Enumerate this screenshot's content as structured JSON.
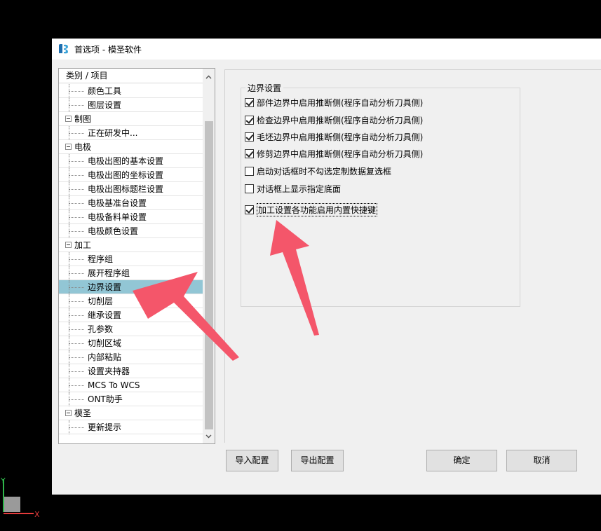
{
  "window": {
    "title": "首选项 - 模圣软件"
  },
  "tree": {
    "header": "类别 / 项目",
    "rows": [
      {
        "kind": "child",
        "label": "颜色工具"
      },
      {
        "kind": "child",
        "label": "图层设置"
      },
      {
        "kind": "group",
        "label": "制图"
      },
      {
        "kind": "child",
        "label": "正在研发中..."
      },
      {
        "kind": "group",
        "label": "电极"
      },
      {
        "kind": "child",
        "label": "电极出图的基本设置"
      },
      {
        "kind": "child",
        "label": "电极出图的坐标设置"
      },
      {
        "kind": "child",
        "label": "电极出图标题栏设置"
      },
      {
        "kind": "child",
        "label": "电极基准台设置"
      },
      {
        "kind": "child",
        "label": "电极备料单设置"
      },
      {
        "kind": "child",
        "label": "电极颜色设置"
      },
      {
        "kind": "group",
        "label": "加工"
      },
      {
        "kind": "child",
        "label": "程序组"
      },
      {
        "kind": "child",
        "label": "展开程序组"
      },
      {
        "kind": "child",
        "label": "边界设置",
        "selected": true
      },
      {
        "kind": "child",
        "label": "切削层"
      },
      {
        "kind": "child",
        "label": "继承设置"
      },
      {
        "kind": "child",
        "label": "孔参数"
      },
      {
        "kind": "child",
        "label": "切削区域"
      },
      {
        "kind": "child",
        "label": "内部粘贴"
      },
      {
        "kind": "child",
        "label": "设置夹持器"
      },
      {
        "kind": "child",
        "label": "MCS To WCS"
      },
      {
        "kind": "child",
        "label": "ONT助手"
      },
      {
        "kind": "group",
        "label": "模圣"
      },
      {
        "kind": "child",
        "label": "更新提示"
      }
    ]
  },
  "settings": {
    "group_title": "边界设置",
    "options": [
      {
        "label": "部件边界中启用推断侧(程序自动分析刀具侧)",
        "checked": true
      },
      {
        "label": "检查边界中启用推断侧(程序自动分析刀具侧)",
        "checked": true
      },
      {
        "label": "毛坯边界中启用推断侧(程序自动分析刀具侧)",
        "checked": true
      },
      {
        "label": "修剪边界中启用推断侧(程序自动分析刀具侧)",
        "checked": true
      },
      {
        "label": "启动对话框时不勾选定制数据复选框",
        "checked": false
      },
      {
        "label": "对话框上显示指定底面",
        "checked": false
      },
      {
        "label": "加工设置各功能启用内置快捷键",
        "checked": true,
        "focused": true
      }
    ]
  },
  "buttons": {
    "import": "导入配置",
    "export": "导出配置",
    "ok": "确定",
    "cancel": "取消"
  },
  "axes": {
    "x": "X",
    "y": "Y"
  },
  "colors": {
    "selection": "#92c6d5",
    "annotation_arrow": "#f4566a"
  }
}
